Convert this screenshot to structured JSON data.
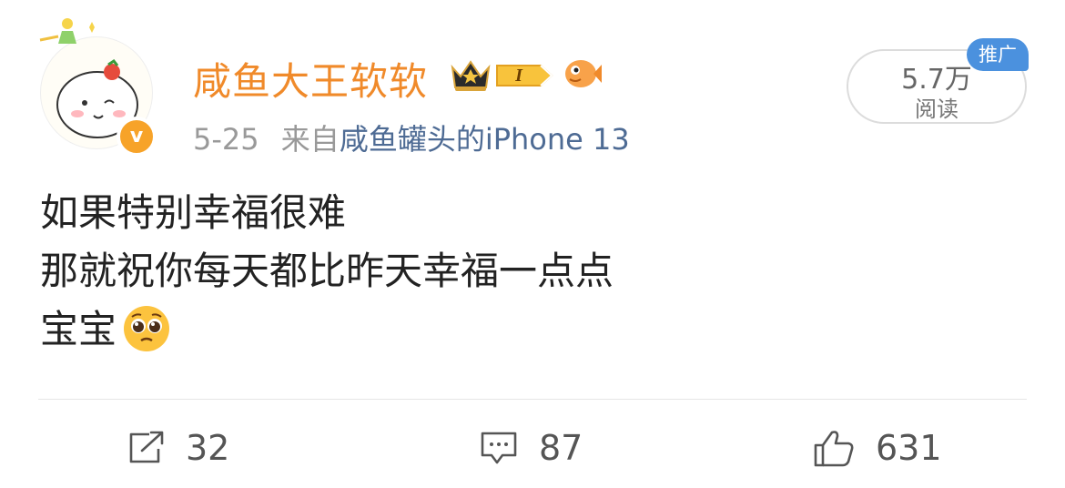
{
  "user": {
    "name": "咸鱼大王软软",
    "level_badge": "I"
  },
  "post_meta": {
    "date": "5-25",
    "from_prefix": "来自",
    "source_app": "咸鱼罐头的iPhone 13"
  },
  "stats": {
    "read_count": "5.7万",
    "read_label": "阅读",
    "promo_tag": "推广"
  },
  "post": {
    "lines": [
      "如果特别幸福很难",
      "那就祝你每天都比昨天幸福一点点",
      "宝宝"
    ]
  },
  "actions": {
    "repost_count": "32",
    "comment_count": "87",
    "like_count": "631"
  },
  "colors": {
    "username": "#f08a2a",
    "source_link": "#4e6b94",
    "promo_tag": "#4b91de",
    "verified_badge": "#f7a329"
  },
  "icons": [
    "crown-icon",
    "fish-icon",
    "verified-icon",
    "pleading-face-emoji",
    "repost-icon",
    "comment-icon",
    "like-icon"
  ]
}
